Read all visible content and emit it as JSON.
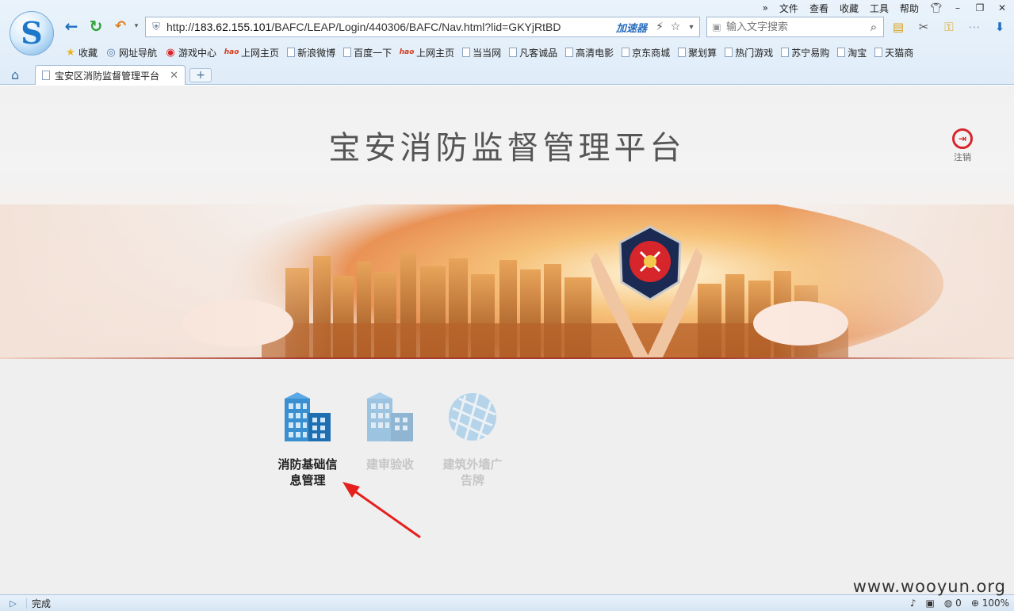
{
  "browser": {
    "menu": [
      "文件",
      "查看",
      "收藏",
      "工具",
      "帮助"
    ],
    "menu_more": "»",
    "address": {
      "url_prefix": "http://",
      "url_host": "183.62.155.101",
      "url_path": "/BAFC/LEAP/Login/440306/BAFC/Nav.html?lid=GKYjRtBD",
      "accelerator": "加速器"
    },
    "search": {
      "placeholder": "输入文字搜索"
    },
    "favorites": [
      {
        "label": "收藏",
        "icon": "star-icon"
      },
      {
        "label": "网址导航",
        "icon": "globe-icon"
      },
      {
        "label": "游戏中心",
        "icon": "game-icon"
      },
      {
        "label": "上网主页",
        "icon": "hao-icon"
      },
      {
        "label": "新浪微博",
        "icon": "page-icon"
      },
      {
        "label": "百度一下",
        "icon": "page-icon"
      },
      {
        "label": "上网主页",
        "icon": "hao-icon"
      },
      {
        "label": "当当网",
        "icon": "page-icon"
      },
      {
        "label": "凡客诚品",
        "icon": "page-icon"
      },
      {
        "label": "高清电影",
        "icon": "page-icon"
      },
      {
        "label": "京东商城",
        "icon": "page-icon"
      },
      {
        "label": "聚划算",
        "icon": "page-icon"
      },
      {
        "label": "热门游戏",
        "icon": "page-icon"
      },
      {
        "label": "苏宁易购",
        "icon": "page-icon"
      },
      {
        "label": "淘宝",
        "icon": "page-icon"
      },
      {
        "label": "天猫商",
        "icon": "page-icon"
      }
    ],
    "tab": {
      "title": "宝安区消防监督管理平台",
      "new_tab": "+"
    },
    "status": {
      "text": "完成",
      "zero": "0",
      "zoom": "100%"
    }
  },
  "page": {
    "title": "宝安消防监督管理平台",
    "logout_label": "注销",
    "apps": [
      {
        "line1": "消防基础信",
        "line2": "息管理",
        "state": "active"
      },
      {
        "line1": "建审验收",
        "line2": "",
        "state": "disabled"
      },
      {
        "line1": "建筑外墙广",
        "line2": "告牌",
        "state": "disabled"
      }
    ]
  },
  "watermark": "www.wooyun.org",
  "colors": {
    "accent_red": "#d7262b",
    "banner_orange": "#e8924a",
    "chrome_blue": "#dfecf8",
    "page_bg": "#efefef"
  }
}
